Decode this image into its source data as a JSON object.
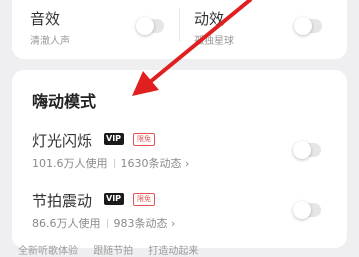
{
  "sound_effect": {
    "title": "音效",
    "subtitle": "清澈人声",
    "enabled": false
  },
  "dynamic_effect": {
    "title": "动效",
    "subtitle": "孤独星球",
    "enabled": false
  },
  "rave_mode": {
    "title": "嗨动模式",
    "items": [
      {
        "title": "灯光闪烁",
        "vip": "VIP",
        "badge": "限免",
        "users": "101.6万人使用",
        "posts": "1630条动态",
        "enabled": false
      },
      {
        "title": "节拍震动",
        "vip": "VIP",
        "badge": "限免",
        "users": "86.6万人使用",
        "posts": "983条动态",
        "enabled": false
      }
    ]
  },
  "bottom_links": [
    "全新听歌体验",
    "跟随节拍",
    "打造动起来"
  ],
  "colors": {
    "arrow": "#e02020",
    "limited": "#e05555",
    "vip": "#1a1a1a",
    "background": "#efeff2"
  },
  "icons": {
    "chevron": "›"
  }
}
